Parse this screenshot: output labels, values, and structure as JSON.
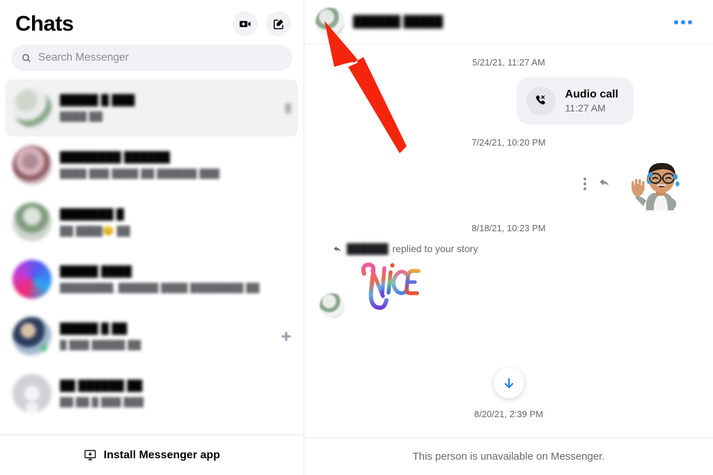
{
  "sidebar": {
    "title": "Chats",
    "actions": [
      {
        "name": "new-video-chat-button",
        "icon": "video-camera-plus-icon"
      },
      {
        "name": "compose-button",
        "icon": "compose-pencil-icon"
      }
    ],
    "search": {
      "placeholder": "Search Messenger",
      "value": "",
      "icon": "search-icon"
    },
    "chats": [
      {
        "name": "█████ █ ███",
        "preview": "████ ██",
        "meta": "█",
        "avatar": "av-a",
        "active": true,
        "badge": ""
      },
      {
        "name": "████████ ██████",
        "preview": "████ ███ ████ ██ ██████ ███",
        "meta": "",
        "avatar": "av-b",
        "active": false,
        "badge": ""
      },
      {
        "name": "███████ █",
        "preview": "██ ████😊 ██",
        "meta": "",
        "avatar": "av-c",
        "active": false,
        "badge": ""
      },
      {
        "name": "█████ ████",
        "preview": "████████, ██████ ████ ████████ ██",
        "meta": "",
        "avatar": "av-d",
        "active": false,
        "badge": ""
      },
      {
        "name": "█████ █ ██",
        "preview": "█ ███ █████ ██",
        "meta": "",
        "avatar": "av-e",
        "active": false,
        "badge": "cross-badge"
      },
      {
        "name": "██ ██████ ██",
        "preview": "██ ██ █ ███ ███",
        "meta": "",
        "avatar": "av-f",
        "active": false,
        "badge": ""
      }
    ],
    "install": {
      "label": "Install Messenger app",
      "icon": "monitor-download-icon"
    }
  },
  "thread": {
    "header": {
      "contact_name": "██████ █████",
      "avatar": "contact-avatar",
      "menu_icon": "more-options-icon",
      "menu_color": "#2d88ff"
    },
    "timestamps": {
      "first": "5/21/21, 11:27 AM",
      "second": "7/24/21, 10:20 PM",
      "third": "8/18/21, 10:23 PM",
      "fourth": "8/20/21, 2:39 PM"
    },
    "call_message": {
      "title": "Audio call",
      "time": "11:27 AM",
      "icon": "missed-call-icon"
    },
    "sticker_message": {
      "icon": "avatar-sticker-laughing",
      "controls": {
        "more": "message-options-icon",
        "reply": "reply-arrow-icon"
      }
    },
    "story_reply": {
      "who": "██████",
      "text": "replied to your story",
      "icon": "reply-arrow-icon",
      "sticker": "NICE"
    },
    "scroll_button": {
      "icon": "arrow-down-icon",
      "color": "#1877f2"
    },
    "footer_notice": "This person is unavailable on Messenger."
  },
  "annotation": {
    "arrow": "red-pointer-arrow",
    "color": "#f4250c"
  }
}
